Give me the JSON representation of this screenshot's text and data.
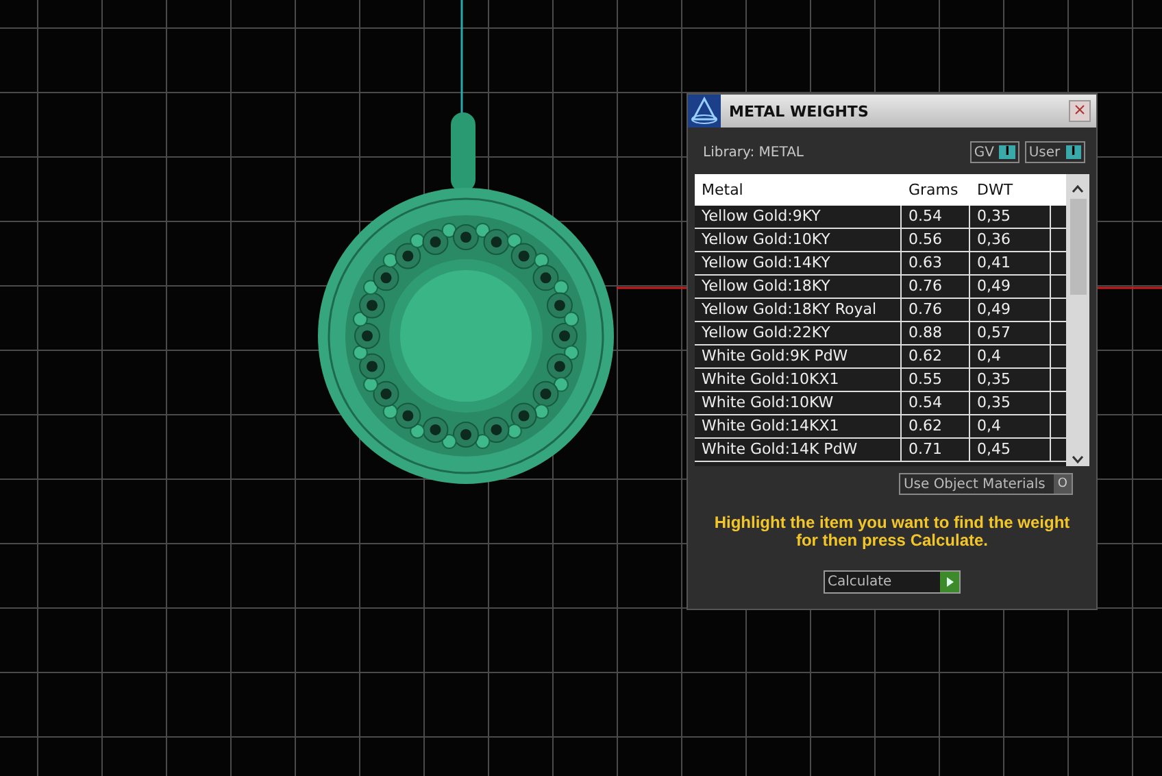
{
  "window": {
    "title": "METAL WEIGHTS"
  },
  "library": {
    "label": "Library: METAL"
  },
  "toggles": [
    {
      "label": "GV",
      "symbol": "I",
      "on": true
    },
    {
      "label": "User",
      "symbol": "I",
      "on": true
    }
  ],
  "table": {
    "columns": [
      "Metal",
      "Grams",
      "DWT"
    ],
    "rows": [
      [
        "Yellow Gold:9KY",
        "0.54",
        "0,35"
      ],
      [
        "Yellow Gold:10KY",
        "0.56",
        "0,36"
      ],
      [
        "Yellow Gold:14KY",
        "0.63",
        "0,41"
      ],
      [
        "Yellow Gold:18KY",
        "0.76",
        "0,49"
      ],
      [
        "Yellow Gold:18KY Royal",
        "0.76",
        "0,49"
      ],
      [
        "Yellow Gold:22KY",
        "0.88",
        "0,57"
      ],
      [
        "White Gold:9K PdW",
        "0.62",
        "0,4"
      ],
      [
        "White Gold:10KX1",
        "0.55",
        "0,35"
      ],
      [
        "White Gold:10KW",
        "0.54",
        "0,35"
      ],
      [
        "White Gold:14KX1",
        "0.62",
        "0,4"
      ],
      [
        "White Gold:14K PdW",
        "0.71",
        "0,45"
      ]
    ]
  },
  "use_object_materials": {
    "label": "Use Object Materials",
    "symbol": "O",
    "on": false
  },
  "hint": "Highlight the item you want to find the weight for then press Calculate.",
  "calculate": {
    "label": "Calculate"
  }
}
